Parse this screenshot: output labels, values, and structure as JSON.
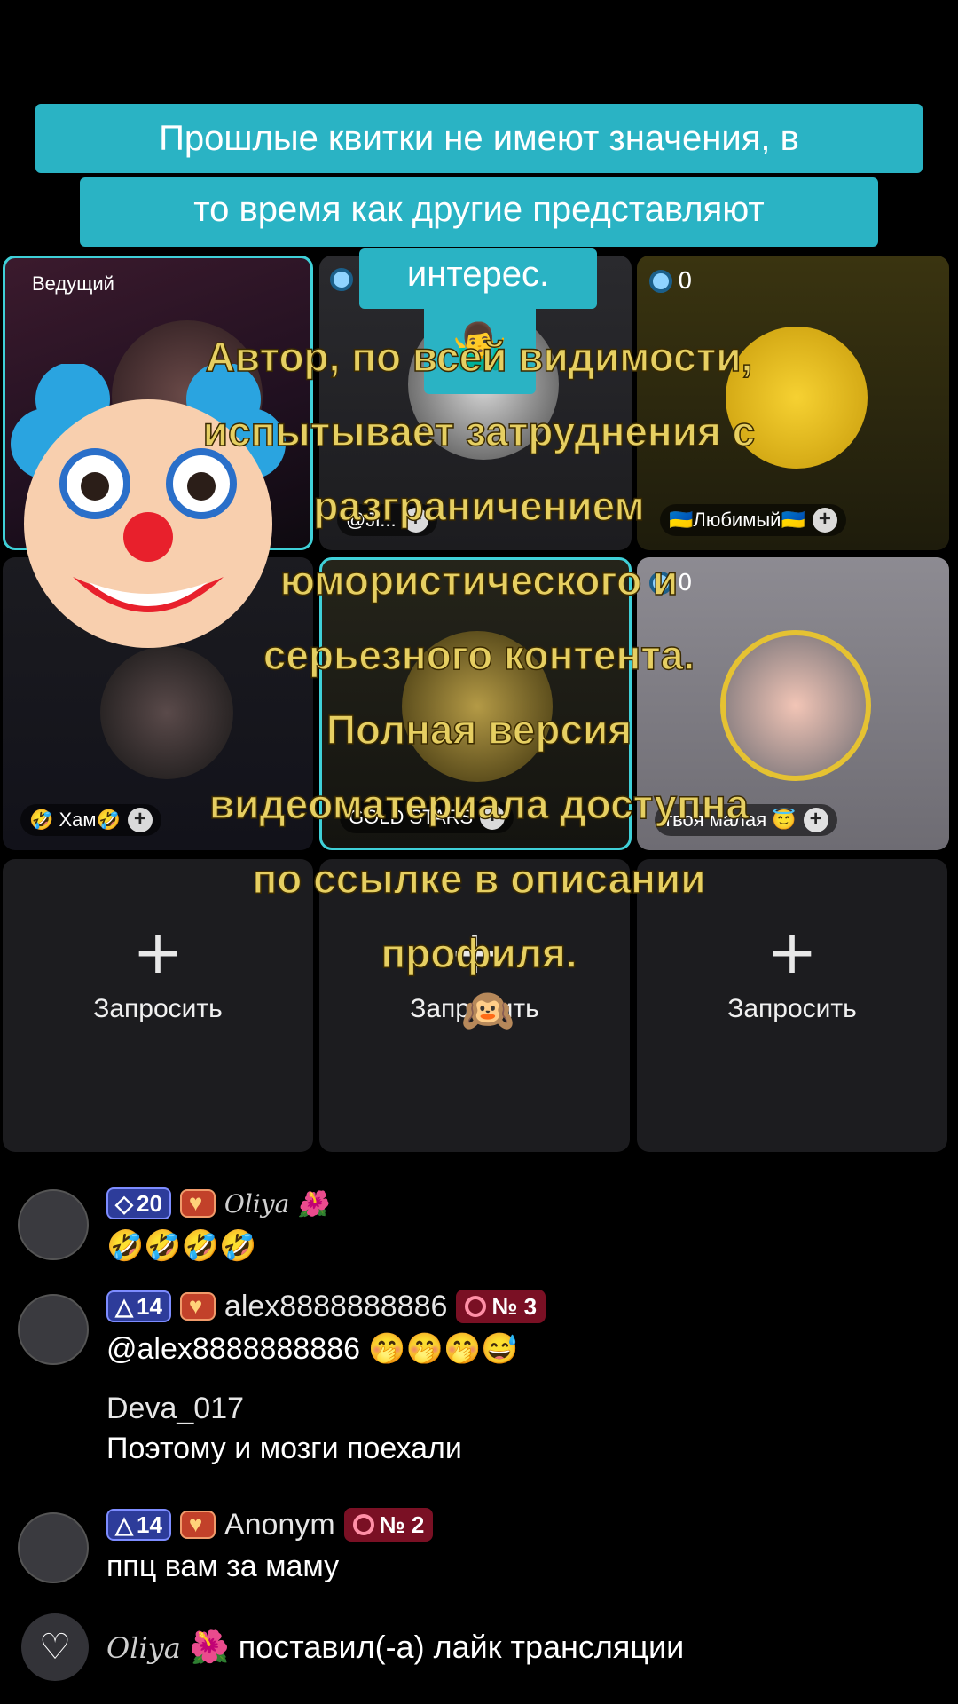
{
  "caption": {
    "line1": "Прошлые квитки не имеют значения, в",
    "line2": "то время как другие представляют",
    "line3": "интерес.",
    "emoji": "🤷‍♂️"
  },
  "overlay": {
    "lines": [
      "Автор, по всей видимости,",
      "испытывает затруднения с",
      "разграничением",
      "юмористического и",
      "серьезного контента.",
      "Полная версия",
      "видеоматериала доступна",
      "по ссылке в описании",
      "профиля."
    ],
    "monkey_emoji": "🙉"
  },
  "grid": {
    "host_label": "Ведущий",
    "t3_count": "0",
    "t3_name": "🇺🇦Любимый🇺🇦",
    "t2_name": "@Ji...",
    "t4_name": "🤣 Хам🤣",
    "t5_name": "GOLD STARS",
    "t6_count": "0",
    "t6_name": "твоя малая 😇",
    "request_label": "Запросить",
    "plus_glyph": "+"
  },
  "chat": [
    {
      "level": "20",
      "name": "Oliya 🌺",
      "message": "🤣🤣🤣🤣"
    },
    {
      "level": "14",
      "name": "alex8888888886",
      "rank": "№ 3",
      "message": "@alex8888888886 🤭🤭🤭😅"
    },
    {
      "name": "Deva_017",
      "message": "Поэтому и мозги поехали"
    },
    {
      "level": "14",
      "name": "Anonym",
      "rank": "№ 2",
      "message": "ппц вам за маму"
    }
  ],
  "like": {
    "user": "Oliya",
    "emoji": "🌺",
    "text": "поставил(-а) лайк трансляции",
    "heart": "♡"
  },
  "colors": {
    "caption_bg": "#2ab3c4",
    "overlay_text": "#e6cf62",
    "tile_border": "#3fd0d8"
  }
}
